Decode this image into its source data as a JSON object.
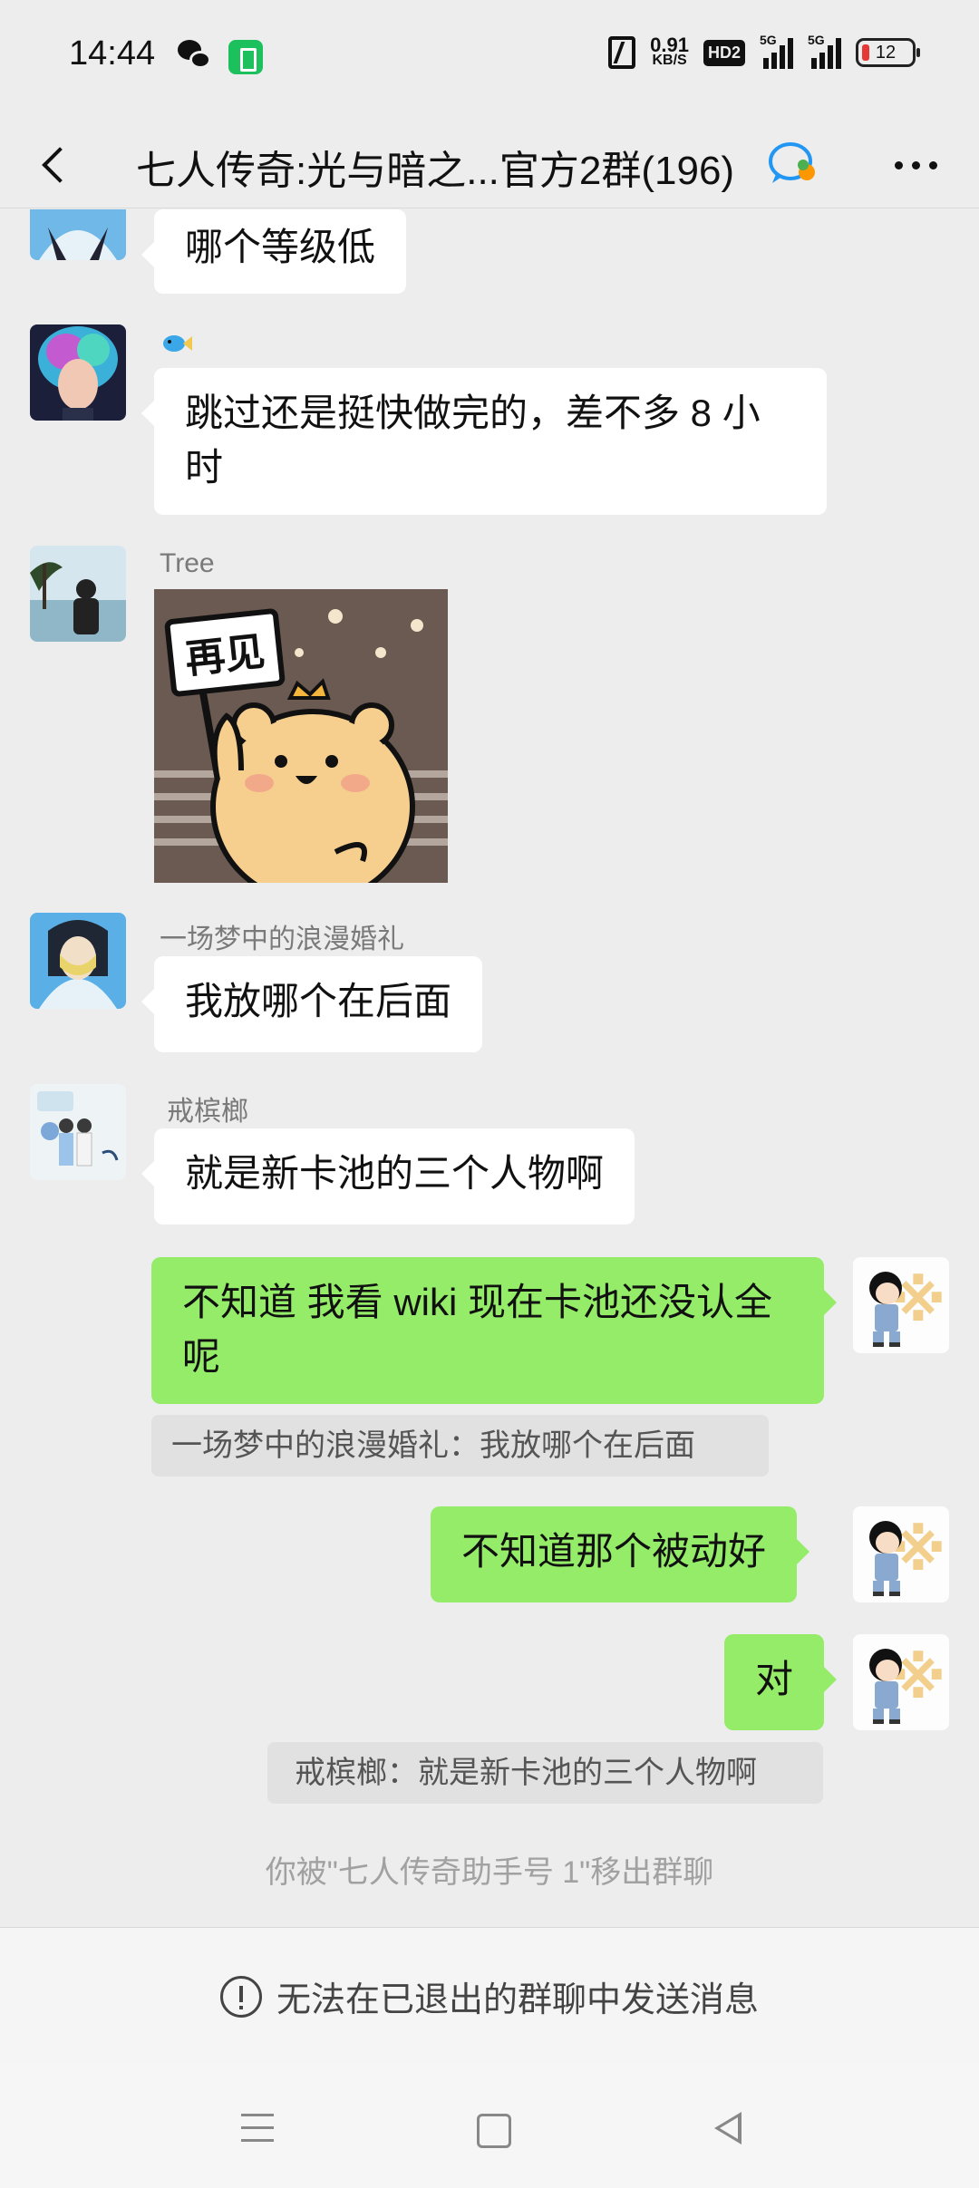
{
  "status_bar": {
    "time": "14:44",
    "speed_value": "0.91",
    "speed_unit": "KB/S",
    "hd_label": "HD2",
    "signal_1_label": "5G",
    "signal_2_label": "5G",
    "battery_level": "12"
  },
  "header": {
    "title": "七人传奇:光与暗之...官方2群(196)"
  },
  "messages": {
    "m1": {
      "text": "哪个等级低"
    },
    "m2": {
      "text": "跳过还是挺快做完的，差不多 8 小时"
    },
    "m3": {
      "sender": "Tree",
      "sticker_text": "再见"
    },
    "m4": {
      "sender": "一场梦中的浪漫婚礼",
      "text": "我放哪个在后面"
    },
    "m5": {
      "sender": "戒槟榔",
      "text": "就是新卡池的三个人物啊"
    },
    "m6": {
      "text": "不知道 我看 wiki 现在卡池还没认全呢",
      "quote": "一场梦中的浪漫婚礼：我放哪个在后面"
    },
    "m7": {
      "text": "不知道那个被动好"
    },
    "m8": {
      "text": "对",
      "quote": "戒槟榔：就是新卡池的三个人物啊"
    }
  },
  "system_notice": "你被\"七人传奇助手号 1\"移出群聊",
  "footer": {
    "notice": "无法在已退出的群聊中发送消息"
  },
  "colors": {
    "background": "#ededed",
    "outgoing_bubble": "#95ec69",
    "incoming_bubble": "#ffffff"
  }
}
